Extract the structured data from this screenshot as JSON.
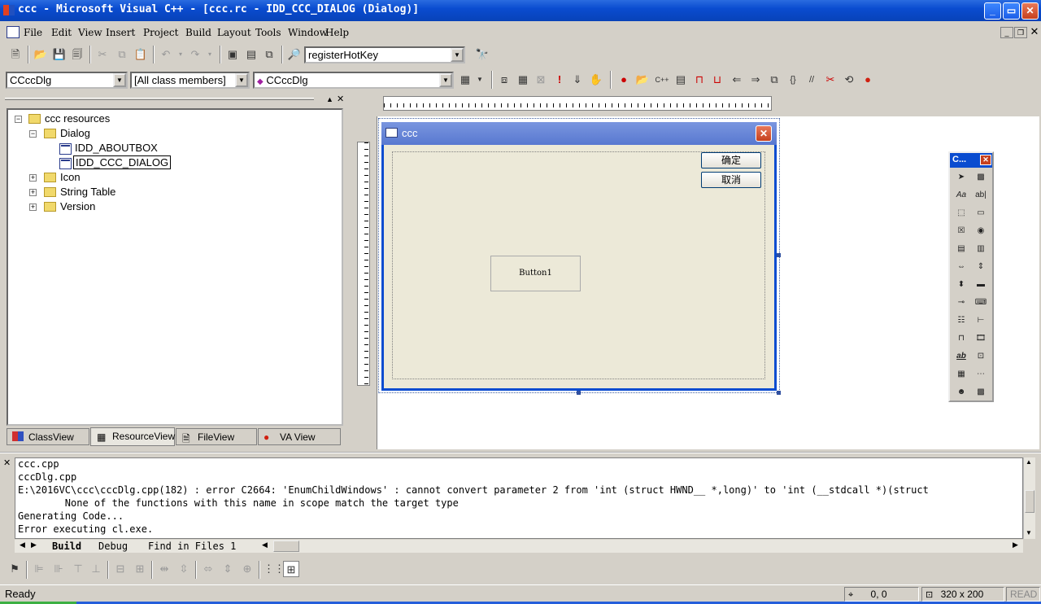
{
  "titlebar": {
    "title": "ccc - Microsoft Visual C++ - [ccc.rc - IDD_CCC_DIALOG (Dialog)]",
    "min": "_",
    "max": "▭",
    "close": "✕"
  },
  "menu": [
    "File",
    "Edit",
    "View",
    "Insert",
    "Project",
    "Build",
    "Layout",
    "Tools",
    "Window",
    "Help"
  ],
  "toolbar": {
    "find_combo": "registerHotKey",
    "class_combo": "CCccDlg",
    "filter_combo": "[All class members]",
    "member_combo": "CCccDlg"
  },
  "tree": {
    "root": "ccc resources",
    "dialog": "Dialog",
    "about": "IDD_ABOUTBOX",
    "main": "IDD_CCC_DIALOG",
    "icon": "Icon",
    "strings": "String Table",
    "version": "Version"
  },
  "workspace_tabs": [
    "ClassView",
    "ResourceView",
    "FileView",
    "VA View"
  ],
  "dialog": {
    "title": "ccc",
    "ok": "确定",
    "cancel": "取消",
    "button1": "Button1"
  },
  "toolbox": {
    "title": "C..."
  },
  "output": {
    "lines": [
      "ccc.cpp",
      "cccDlg.cpp",
      "E:\\2016VC\\ccc\\cccDlg.cpp(182) : error C2664: 'EnumChildWindows' : cannot convert parameter 2 from 'int (struct HWND__ *,long)' to 'int (__stdcall *)(struct",
      "        None of the functions with this name in scope match the target type",
      "Generating Code...",
      "Error executing cl.exe."
    ],
    "tabs": [
      "Build",
      "Debug",
      "Find in Files 1"
    ]
  },
  "status": {
    "text": "Ready",
    "pos": "0, 0",
    "size": "320 x 200",
    "mode": "READ"
  }
}
